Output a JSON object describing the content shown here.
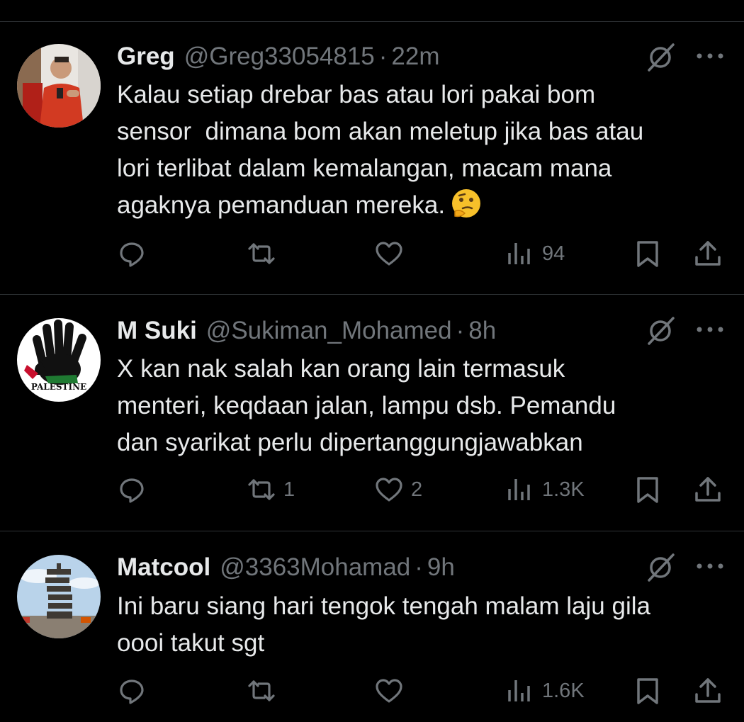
{
  "colors": {
    "background": "#000000",
    "text": "#e7e9ea",
    "muted": "#71767b",
    "divider": "#2f3336"
  },
  "tweets": [
    {
      "name": "Greg",
      "handle": "@Greg33054815",
      "dot": "·",
      "time": "22m",
      "text": "Kalau setiap drebar bas atau lori pakai bom\nsensor  dimana bom akan meletup jika bas atau\nlori terlibat dalam kemalangan, macam mana\nagaknya pemanduan mereka.",
      "emoji": "thinking-face",
      "replies": "",
      "reposts": "",
      "likes": "",
      "views": "94"
    },
    {
      "name": "M Suki",
      "handle": "@Sukiman_Mohamed",
      "dot": "·",
      "time": "8h",
      "text": "X kan nak salah kan orang lain termasuk\nmenteri, keqdaan jalan, lampu dsb. Pemandu\ndan syarikat perlu dipertanggungjawabkan",
      "avatar_text": "PALESTINE",
      "replies": "",
      "reposts": "1",
      "likes": "2",
      "views": "1.3K"
    },
    {
      "name": "Matcool",
      "handle": "@3363Mohamad",
      "dot": "·",
      "time": "9h",
      "text": "Ini baru siang hari tengok tengah malam laju gila\noooi takut sgt",
      "replies": "",
      "reposts": "",
      "likes": "",
      "views": "1.6K"
    }
  ],
  "icons": [
    "reply-icon",
    "repost-icon",
    "like-icon",
    "views-icon",
    "bookmark-icon",
    "share-icon",
    "grok-icon",
    "more-icon"
  ]
}
